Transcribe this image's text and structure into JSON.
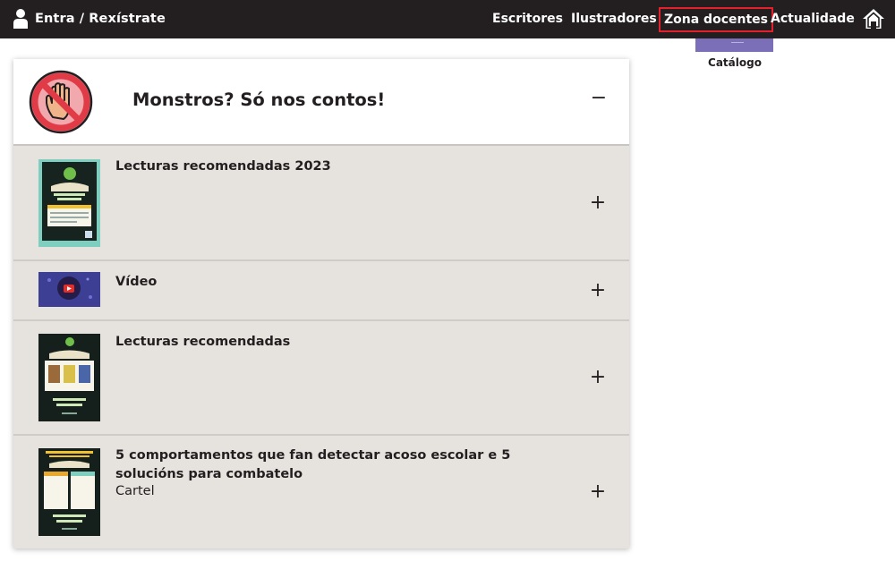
{
  "header": {
    "login_label": "Entra / Rexístrate",
    "nav": [
      "Escritores",
      "Ilustradores",
      "Zona docentes",
      "Actualidade"
    ],
    "active_nav": "Zona docentes",
    "icons": {
      "user": "user-icon",
      "home": "home-icon"
    }
  },
  "sidebar": {
    "catalog_label": "Catálogo"
  },
  "accordion": {
    "title": "Monstros? Só nos contos!",
    "header_icon": "stop-hand-icon",
    "toggle_open": "−",
    "items": [
      {
        "title": "Lecturas recomendadas 2023",
        "subtitle": "",
        "toggle": "+"
      },
      {
        "title": "Vídeo",
        "subtitle": "",
        "toggle": "+"
      },
      {
        "title": "Lecturas recomendadas",
        "subtitle": "",
        "toggle": "+"
      },
      {
        "title": "5 comportamentos que fan detectar acoso escolar e 5 solucións para combatelo",
        "subtitle": "Cartel",
        "toggle": "+"
      }
    ]
  },
  "colors": {
    "topbar": "#231f20",
    "active_outline": "#e3202c",
    "card_bg": "#e6e3df",
    "stop_red": "#e03b47"
  }
}
